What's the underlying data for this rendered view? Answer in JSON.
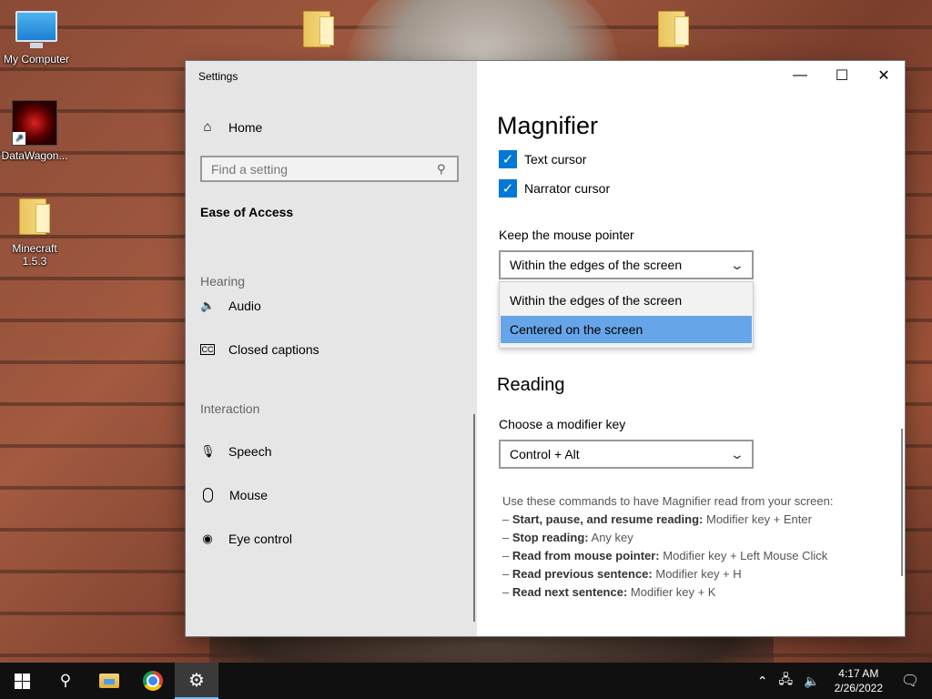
{
  "desktop": {
    "icons": [
      {
        "label": "My Computer"
      },
      {
        "label": "DataWagon..."
      },
      {
        "label": "Minecraft 1.5.3"
      }
    ]
  },
  "window": {
    "title": "Settings",
    "controls": {
      "minimize": "—",
      "maximize": "☐",
      "close": "✕"
    }
  },
  "nav": {
    "home": "Home",
    "search_placeholder": "Find a setting",
    "category": "Ease of Access",
    "sections": [
      {
        "heading": "Hearing",
        "items": [
          {
            "label": "Audio",
            "icon": "speaker-icon"
          },
          {
            "label": "Closed captions",
            "icon": "closed-captions-icon"
          }
        ]
      },
      {
        "heading": "Interaction",
        "items": [
          {
            "label": "Speech",
            "icon": "microphone-icon"
          },
          {
            "label": "Mouse",
            "icon": "mouse-icon"
          },
          {
            "label": "Eye control",
            "icon": "eye-control-icon"
          }
        ]
      }
    ]
  },
  "content": {
    "title": "Magnifier",
    "checkboxes": [
      {
        "label": "Text cursor",
        "checked": true
      },
      {
        "label": "Narrator cursor",
        "checked": true
      }
    ],
    "mouse_pointer": {
      "label": "Keep the mouse pointer",
      "selected": "Within the edges of the screen",
      "options": [
        "Within the edges of the screen",
        "Centered on the screen"
      ],
      "highlighted": "Centered on the screen"
    },
    "reading": {
      "title": "Reading",
      "modifier_label": "Choose a modifier key",
      "modifier_value": "Control + Alt",
      "intro": "Use these commands to have Magnifier read from your screen:",
      "commands": [
        {
          "name": "Start, pause, and resume reading:",
          "keys": "Modifier key + Enter"
        },
        {
          "name": "Stop reading:",
          "keys": "Any key"
        },
        {
          "name": "Read from mouse pointer:",
          "keys": "Modifier key + Left Mouse Click"
        },
        {
          "name": "Read previous sentence:",
          "keys": "Modifier key + H"
        },
        {
          "name": "Read next sentence:",
          "keys": "Modifier key + K"
        }
      ]
    }
  },
  "taskbar": {
    "time": "4:17 AM",
    "date": "2/26/2022",
    "accent": "#76b9ed"
  },
  "colors": {
    "checkbox": "#0078d7",
    "dropdown_highlight": "#66a5e8",
    "nav_bg": "#e6e6e6"
  }
}
